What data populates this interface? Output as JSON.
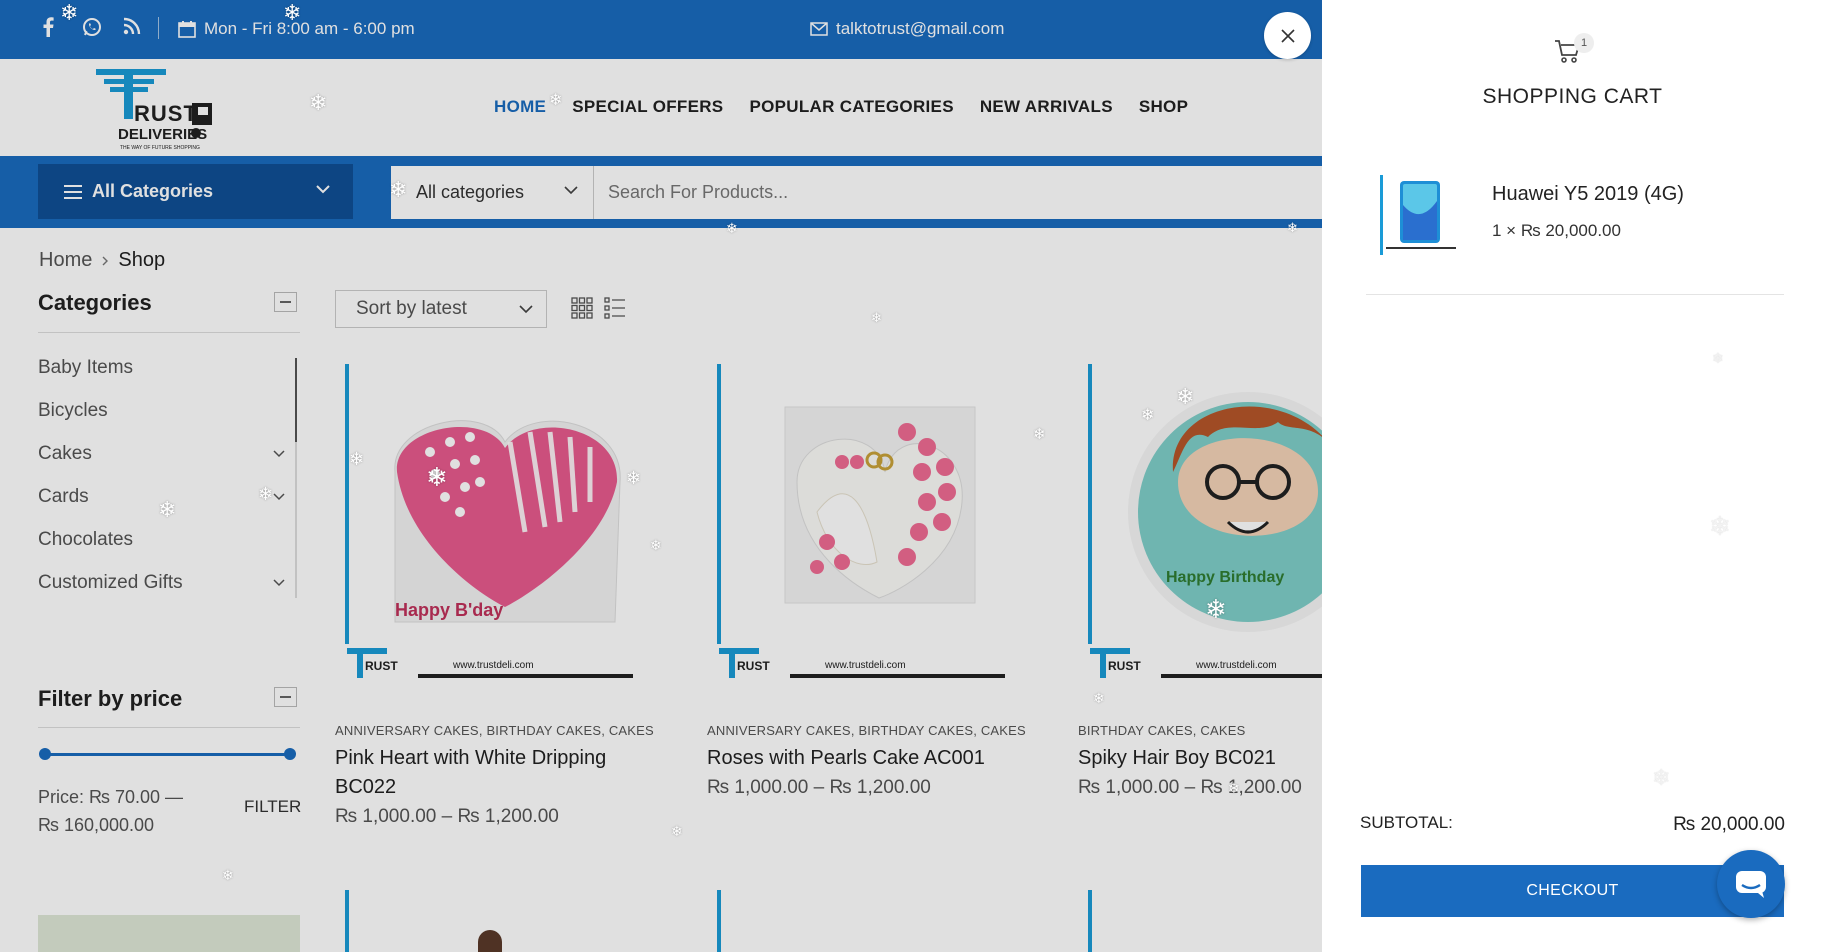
{
  "topbar": {
    "hours": "Mon - Fri 8:00 am - 6:00 pm",
    "email": "talktotrust@gmail.com",
    "social_icons": [
      "facebook-icon",
      "whatsapp-icon",
      "rss-icon"
    ]
  },
  "brand": {
    "logo_text": "TRUST DELIVERIES",
    "tagline": "THE WAY OF FUTURE SHOPPING",
    "primary_color": "#1a6bbf"
  },
  "nav": {
    "items": [
      {
        "label": "HOME",
        "active": true
      },
      {
        "label": "SPECIAL OFFERS",
        "active": false
      },
      {
        "label": "POPULAR CATEGORIES",
        "active": false
      },
      {
        "label": "NEW ARRIVALS",
        "active": false
      },
      {
        "label": "SHOP",
        "active": false
      }
    ]
  },
  "searchbar": {
    "all_categories": "All Categories",
    "category_select": "All categories",
    "placeholder": "Search For Products..."
  },
  "breadcrumb": {
    "home": "Home",
    "current": "Shop"
  },
  "sidebar": {
    "categories_title": "Categories",
    "categories": [
      {
        "label": "Baby Items",
        "expandable": false
      },
      {
        "label": "Bicycles",
        "expandable": false
      },
      {
        "label": "Cakes",
        "expandable": true
      },
      {
        "label": "Cards",
        "expandable": true
      },
      {
        "label": "Chocolates",
        "expandable": false
      },
      {
        "label": "Customized Gifts",
        "expandable": true
      }
    ],
    "filter_title": "Filter by price",
    "price_label": "Price:",
    "price_min": "₨ 70.00",
    "price_dash": "—",
    "price_max": "₨ 160,000.00",
    "filter_button": "FILTER"
  },
  "toolbar": {
    "sort_label": "Sort by latest"
  },
  "products": [
    {
      "categories": [
        "ANNIVERSARY CAKES",
        "BIRTHDAY CAKES",
        "CAKES"
      ],
      "name": "Pink Heart with White Dripping BC022",
      "price_from": "₨ 1,000.00",
      "price_to": "₨ 1,200.00",
      "watermark": "www.trustdeli.com",
      "cake_text": "Happy B'day"
    },
    {
      "categories": [
        "ANNIVERSARY CAKES",
        "BIRTHDAY CAKES",
        "CAKES"
      ],
      "name": "Roses with Pearls Cake AC001",
      "price_from": "₨ 1,000.00",
      "price_to": "₨ 1,200.00",
      "watermark": "www.trustdeli.com"
    },
    {
      "categories": [
        "BIRTHDAY CAKES",
        "CAKES"
      ],
      "name": "Spiky Hair Boy BC021",
      "price_from": "₨ 1,000.00",
      "price_to": "₨ 1,200.00",
      "watermark": "www.trustdeli.com",
      "cake_text": "Happy Birthday"
    }
  ],
  "cart": {
    "title": "SHOPPING CART",
    "count": "1",
    "item_name": "Huawei Y5 2019 (4G)",
    "item_qty": "1 × ₨ 20,000.00",
    "subtotal_label": "SUBTOTAL:",
    "subtotal_value": "₨ 20,000.00",
    "checkout_label": "CHECKOUT"
  }
}
